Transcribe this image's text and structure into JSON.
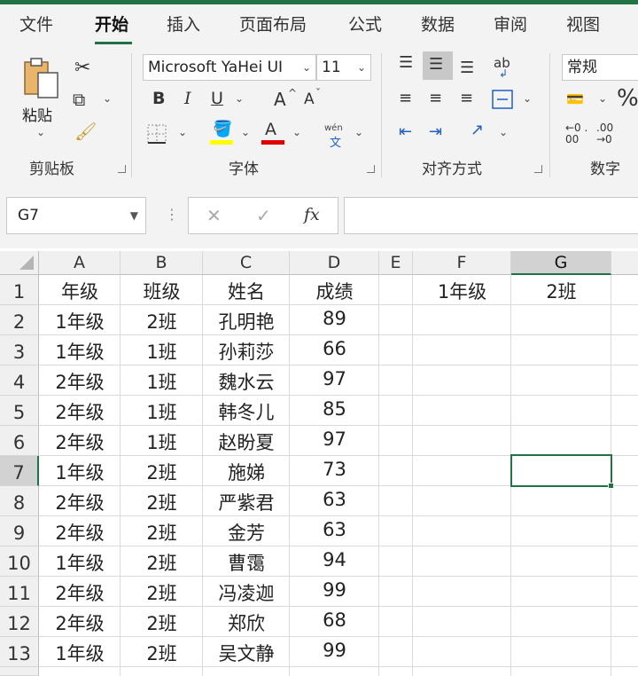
{
  "ribbon": {
    "tabs": [
      "文件",
      "开始",
      "插入",
      "页面布局",
      "公式",
      "数据",
      "审阅",
      "视图"
    ],
    "active_tab": "开始",
    "clipboard": {
      "paste_label": "粘贴",
      "group_label": "剪贴板"
    },
    "font": {
      "name": "Microsoft YaHei UI",
      "size": "11",
      "group_label": "字体",
      "bold": "B",
      "italic": "I",
      "underline": "U",
      "grow": "A",
      "shrink": "A",
      "font_color_glyph": "A",
      "phonetic": "wén",
      "phonetic_char": "文",
      "highlight_color": "#ffff00",
      "font_color": "#e00000"
    },
    "alignment": {
      "group_label": "对齐方式",
      "wrap_glyph": "ab"
    },
    "number": {
      "format": "常规",
      "group_label": "数字",
      "percent": "%",
      "inc_decimal": "←0 .00",
      "dec_decimal": ".00 →0"
    }
  },
  "formula_bar": {
    "name_box": "G7",
    "fx": "fx",
    "value": ""
  },
  "sheet": {
    "columns": [
      "A",
      "B",
      "C",
      "D",
      "E",
      "F",
      "G"
    ],
    "selected_column": "G",
    "selected_row": "7",
    "rows": [
      {
        "num": "1",
        "A": "年级",
        "B": "班级",
        "C": "姓名",
        "D": "成绩",
        "F": "1年级",
        "G": "2班"
      },
      {
        "num": "2",
        "A": "1年级",
        "B": "2班",
        "C": "孔明艳",
        "D": "89"
      },
      {
        "num": "3",
        "A": "1年级",
        "B": "1班",
        "C": "孙莉莎",
        "D": "66"
      },
      {
        "num": "4",
        "A": "2年级",
        "B": "1班",
        "C": "魏水云",
        "D": "97"
      },
      {
        "num": "5",
        "A": "2年级",
        "B": "1班",
        "C": "韩冬儿",
        "D": "85"
      },
      {
        "num": "6",
        "A": "2年级",
        "B": "1班",
        "C": "赵盼夏",
        "D": "97"
      },
      {
        "num": "7",
        "A": "1年级",
        "B": "2班",
        "C": "施娣",
        "D": "73"
      },
      {
        "num": "8",
        "A": "2年级",
        "B": "2班",
        "C": "严紫君",
        "D": "63"
      },
      {
        "num": "9",
        "A": "2年级",
        "B": "2班",
        "C": "金芳",
        "D": "63"
      },
      {
        "num": "10",
        "A": "1年级",
        "B": "2班",
        "C": "曹霭",
        "D": "94"
      },
      {
        "num": "11",
        "A": "2年级",
        "B": "2班",
        "C": "冯凌迦",
        "D": "99"
      },
      {
        "num": "12",
        "A": "2年级",
        "B": "2班",
        "C": "郑欣",
        "D": "68"
      },
      {
        "num": "13",
        "A": "1年级",
        "B": "2班",
        "C": "吴文静",
        "D": "99"
      }
    ]
  },
  "colors": {
    "accent": "#217346",
    "ribbon_bg": "#f3f3f3",
    "header_bg": "#f0f0f0",
    "selected_header_bg": "#d2d2d2"
  }
}
